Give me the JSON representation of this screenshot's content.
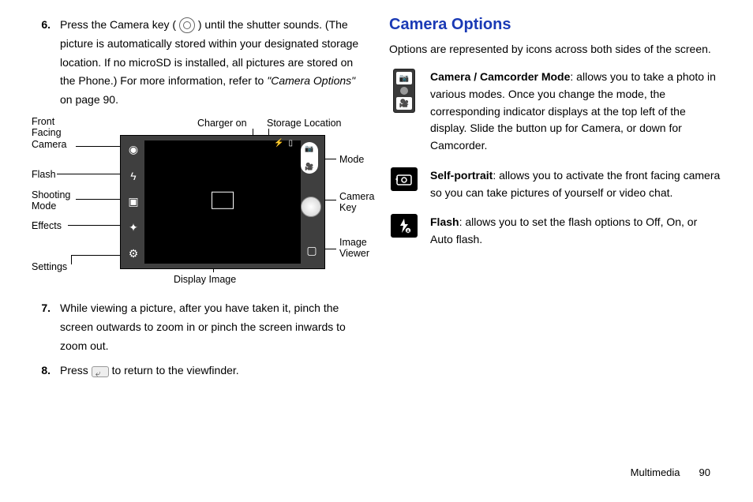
{
  "left": {
    "step6": {
      "num": "6.",
      "text_a": "Press the Camera key (",
      "text_b": ") until the shutter sounds. (The picture is automatically stored within your designated storage location. If no microSD is installed, all pictures are stored on the Phone.) For more information, refer to ",
      "text_c": "\"Camera Options\"",
      "text_d": "  on page 90."
    },
    "diagram": {
      "labels": {
        "front_facing": "Front Facing Camera",
        "flash": "Flash",
        "shooting_mode": "Shooting Mode",
        "effects": "Effects",
        "settings": "Settings",
        "charger_on": "Charger on",
        "storage_location": "Storage Location",
        "mode": "Mode",
        "camera_key": "Camera Key",
        "image_viewer": "Image Viewer",
        "display_image": "Display Image"
      }
    },
    "step7": {
      "num": "7.",
      "text": "While viewing a picture, after you have taken it, pinch the screen outwards to zoom in or pinch the screen inwards to zoom out."
    },
    "step8": {
      "num": "8.",
      "text_a": "Press ",
      "text_b": " to return to the viewfinder."
    }
  },
  "right": {
    "heading": "Camera Options",
    "intro": "Options are represented by icons across both sides of the screen.",
    "options": [
      {
        "title": "Camera / Camcorder Mode",
        "desc": ": allows you to take a photo in various modes. Once you change the mode, the corresponding indicator displays at the top left of the display. Slide the button up for Camera, or down for Camcorder."
      },
      {
        "title": "Self-portrait",
        "desc": ": allows you to activate the front facing camera so you can take pictures of yourself or video chat."
      },
      {
        "title": "Flash",
        "desc": ": allows you to set the flash options to Off, On, or Auto flash."
      }
    ]
  },
  "footer": {
    "section": "Multimedia",
    "page": "90"
  }
}
